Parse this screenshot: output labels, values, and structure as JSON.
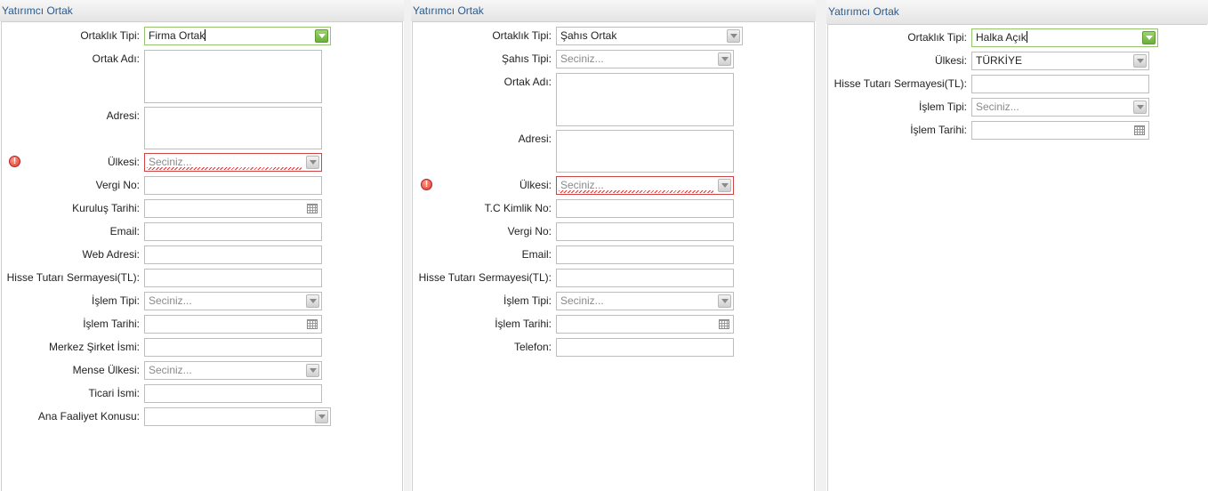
{
  "panels": [
    {
      "title": "Yatırımcı Ortak",
      "fields": [
        {
          "label": "Ortaklık Tipi:",
          "value": "Firma Ortak",
          "placeholder": ""
        },
        {
          "label": "Ortak Adı:",
          "value": "",
          "placeholder": ""
        },
        {
          "label": "Adresi:",
          "value": "",
          "placeholder": ""
        },
        {
          "label": "Ülkesi:",
          "value": "",
          "placeholder": "Seciniz..."
        },
        {
          "label": "Vergi No:",
          "value": "",
          "placeholder": ""
        },
        {
          "label": "Kuruluş Tarihi:",
          "value": "",
          "placeholder": ""
        },
        {
          "label": "Email:",
          "value": "",
          "placeholder": ""
        },
        {
          "label": "Web Adresi:",
          "value": "",
          "placeholder": ""
        },
        {
          "label": "Hisse Tutarı Sermayesi(TL):",
          "value": "",
          "placeholder": ""
        },
        {
          "label": "İşlem Tipi:",
          "value": "",
          "placeholder": "Seciniz..."
        },
        {
          "label": "İşlem Tarihi:",
          "value": "",
          "placeholder": ""
        },
        {
          "label": "Merkez Şirket İsmi:",
          "value": "",
          "placeholder": ""
        },
        {
          "label": "Mense Ülkesi:",
          "value": "",
          "placeholder": "Seciniz..."
        },
        {
          "label": "Ticari İsmi:",
          "value": "",
          "placeholder": ""
        },
        {
          "label": "Ana Faaliyet Konusu:",
          "value": "",
          "placeholder": ""
        }
      ]
    },
    {
      "title": "Yatırımcı Ortak",
      "fields": [
        {
          "label": "Ortaklık Tipi:",
          "value": "Şahıs Ortak",
          "placeholder": ""
        },
        {
          "label": "Şahıs Tipi:",
          "value": "",
          "placeholder": "Seciniz..."
        },
        {
          "label": "Ortak Adı:",
          "value": "",
          "placeholder": ""
        },
        {
          "label": "Adresi:",
          "value": "",
          "placeholder": ""
        },
        {
          "label": "Ülkesi:",
          "value": "",
          "placeholder": "Seciniz..."
        },
        {
          "label": "T.C Kimlik No:",
          "value": "",
          "placeholder": ""
        },
        {
          "label": "Vergi No:",
          "value": "",
          "placeholder": ""
        },
        {
          "label": "Email:",
          "value": "",
          "placeholder": ""
        },
        {
          "label": "Hisse Tutarı Sermayesi(TL):",
          "value": "",
          "placeholder": ""
        },
        {
          "label": "İşlem Tipi:",
          "value": "",
          "placeholder": "Seciniz..."
        },
        {
          "label": "İşlem Tarihi:",
          "value": "",
          "placeholder": ""
        },
        {
          "label": "Telefon:",
          "value": "",
          "placeholder": ""
        }
      ]
    },
    {
      "title": "Yatırımcı Ortak",
      "fields": [
        {
          "label": "Ortaklık Tipi:",
          "value": "Halka Açık",
          "placeholder": ""
        },
        {
          "label": "Ülkesi:",
          "value": "TÜRKİYE",
          "placeholder": ""
        },
        {
          "label": "Hisse Tutarı Sermayesi(TL):",
          "value": "",
          "placeholder": ""
        },
        {
          "label": "İşlem Tipi:",
          "value": "",
          "placeholder": "Seciniz..."
        },
        {
          "label": "İşlem Tarihi:",
          "value": "",
          "placeholder": ""
        }
      ]
    }
  ],
  "icons": {
    "dropdown": "chevron-down-icon",
    "dropdown_active": "chevron-down-icon",
    "calendar": "calendar-icon",
    "error": "error-icon"
  },
  "colors": {
    "header_text": "#2a5a8c",
    "focus_border": "#94c46b",
    "invalid_border": "#cc4444",
    "error_icon": "#d6392a"
  }
}
